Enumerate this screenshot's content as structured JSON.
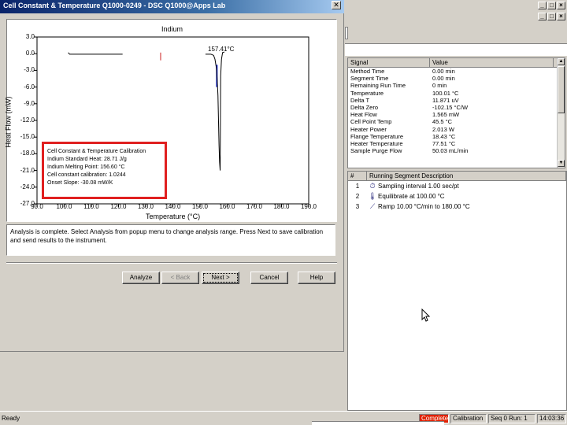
{
  "dialog": {
    "title": "Cell Constant & Temperature Q1000-0249 - DSC Q1000@Apps Lab",
    "close_glyph": "✕",
    "plot": {
      "title": "Indium",
      "peak_label": "157.41°C",
      "xlabel": "Temperature (°C)",
      "ylabel": "Heat Flow (mW)"
    },
    "results": [
      "Cell Constant & Temperature Calibration",
      "Indium Standard Heat: 28.71 J/g",
      "Indium Melting Point: 156.60 °C",
      "Cell constant calibration: 1.0244",
      "Onset Slope: -30.08 mW/K"
    ],
    "message": "Analysis is complete. Select Analysis from popup menu to change analysis range. Press Next to save calibration and send results to the instrument.",
    "buttons": {
      "analyze": "Analyze",
      "back": "< Back",
      "next": "Next >",
      "cancel": "Cancel",
      "help": "Help"
    }
  },
  "chart_data": {
    "type": "line",
    "title": "Indium",
    "xlabel": "Temperature (°C)",
    "ylabel": "Heat Flow (mW)",
    "xlim": [
      90,
      190
    ],
    "ylim": [
      -27,
      3
    ],
    "x_ticks": [
      "90.0",
      "100.0",
      "110.0",
      "120.0",
      "130.0",
      "140.0",
      "150.0",
      "160.0",
      "170.0",
      "180.0",
      "190.0"
    ],
    "y_ticks": [
      "3.0",
      "0.0",
      "-3.0",
      "-6.0",
      "-9.0",
      "-12.0",
      "-15.0",
      "-18.0",
      "-21.0",
      "-24.0",
      "-27.0"
    ],
    "series": [
      {
        "x": [
          101.5,
          102,
          105,
          110,
          115,
          120,
          121.5,
          152,
          154,
          155,
          155.5,
          156,
          156.3,
          156.6,
          156.8,
          157,
          157.2,
          157.41,
          157.6,
          157.9,
          158.3,
          159
        ],
        "y": [
          0.2,
          -0.1,
          -0.1,
          -0.1,
          -0.1,
          -0.1,
          -0.1,
          -0.1,
          -0.1,
          -0.3,
          -1.0,
          -2.5,
          -4.5,
          -7.5,
          -12,
          -16.5,
          -19.5,
          -21.0,
          -4.0,
          -1.0,
          0.2,
          0.3
        ]
      }
    ],
    "annotations": [
      {
        "x": 157.41,
        "label": "157.41°C"
      }
    ]
  },
  "main": {
    "signal_table": {
      "headers": [
        "Signal",
        "Value"
      ],
      "rows": [
        [
          "Method Time",
          "0.00 min"
        ],
        [
          "Segment Time",
          "0.00 min"
        ],
        [
          "Remaining Run Time",
          "0 min"
        ],
        [
          "Temperature",
          "100.01 °C"
        ],
        [
          "Delta T",
          "11.871 uV"
        ],
        [
          "Delta Zero",
          "-102.15 °C/W"
        ],
        [
          "Heat Flow",
          "1.565 mW"
        ],
        [
          "Cell Point Temp",
          "45.5 °C"
        ],
        [
          "Heater Power",
          "2.013 W"
        ],
        [
          "Flange Temperature",
          "18.43 °C"
        ],
        [
          "Heater Temperature",
          "77.51 °C"
        ],
        [
          "Sample Purge Flow",
          "50.03 mL/min"
        ]
      ]
    },
    "segments": {
      "headers": [
        "#",
        "Running Segment Description"
      ],
      "rows": [
        {
          "num": "1",
          "icon": "clock-icon",
          "glyph": "⏱",
          "text": "Sampling interval 1.00 sec/pt"
        },
        {
          "num": "2",
          "icon": "thermometer-icon",
          "glyph": "🌡",
          "text": "Equilibrate at 100.00 °C"
        },
        {
          "num": "3",
          "icon": "ramp-icon",
          "glyph": "⟋",
          "text": "Ramp 10.00 °C/min to 180.00 °C"
        }
      ]
    }
  },
  "statusbar": {
    "ready": "Ready",
    "complete": "Complete",
    "calibration": "Calibration",
    "seq_run": "Seq 0 Run: 1",
    "time": "14:03:36",
    "complete_color": "#e02000"
  }
}
